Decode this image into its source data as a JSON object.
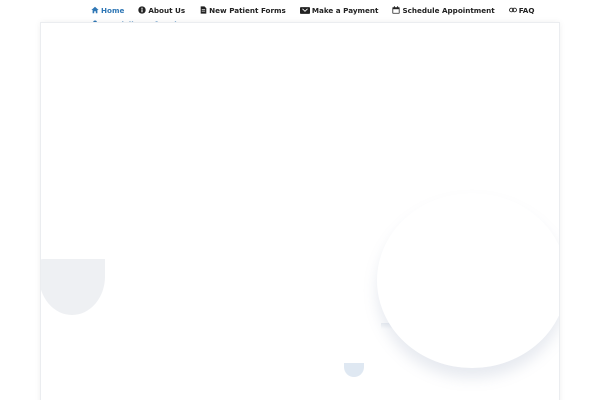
{
  "nav": {
    "items": [
      {
        "label": "Home",
        "icon": "home-icon",
        "active": true
      },
      {
        "label": "About Us",
        "icon": "info-circle-icon"
      },
      {
        "label": "New Patient Forms",
        "icon": "document-icon"
      },
      {
        "label": "Make a Payment",
        "icon": "credit-card-icon"
      },
      {
        "label": "Schedule Appointment",
        "icon": "calendar-icon"
      },
      {
        "label": "FAQ",
        "icon": "link-icon"
      }
    ],
    "dropdown": {
      "label": "Specialist Referrals",
      "icon": "doctor-icon",
      "caret": "chevron-down-icon"
    }
  },
  "colors": {
    "accent": "#2f77b5",
    "text": "#222222",
    "card_border": "#ebedf0",
    "shape_gray": "#eef0f3",
    "shape_blue": "#dfe8f2"
  }
}
